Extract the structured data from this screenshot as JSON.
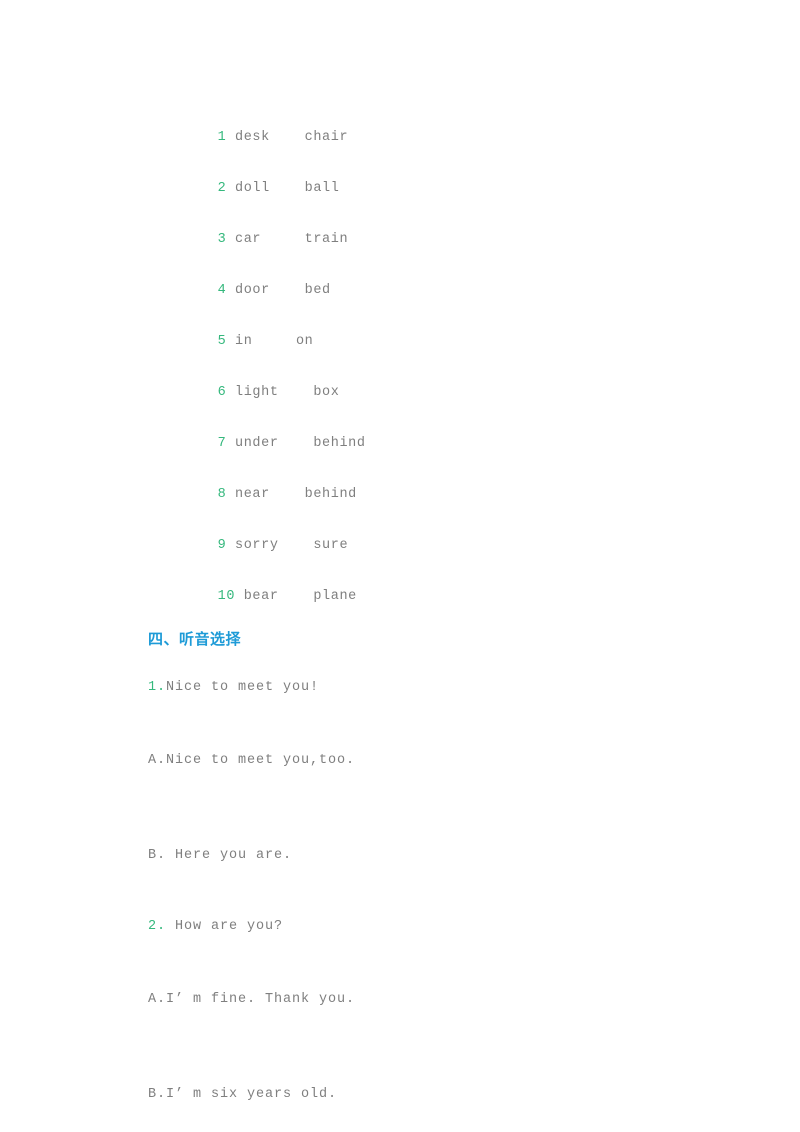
{
  "document": {
    "background_color": "#ffffff",
    "number_color": "#35b87d",
    "text_color": "#7f7f7f",
    "heading_color": "#1e9bd7"
  },
  "word_pairs": {
    "items": [
      {
        "number": "1",
        "word_a": "desk",
        "word_b": "chair",
        "gap": "    "
      },
      {
        "number": "2",
        "word_a": "doll",
        "word_b": "ball",
        "gap": "    "
      },
      {
        "number": "3",
        "word_a": "car",
        "word_b": "train",
        "gap": "     "
      },
      {
        "number": "4",
        "word_a": "door",
        "word_b": "bed",
        "gap": "    "
      },
      {
        "number": "5",
        "word_a": "in",
        "word_b": "on",
        "gap": "     "
      },
      {
        "number": "6",
        "word_a": "light",
        "word_b": "box",
        "gap": "    "
      },
      {
        "number": "7",
        "word_a": "under",
        "word_b": "behind",
        "gap": "    "
      },
      {
        "number": "8",
        "word_a": "near",
        "word_b": "behind",
        "gap": "    "
      },
      {
        "number": "9",
        "word_a": "sorry",
        "word_b": "sure",
        "gap": "    "
      },
      {
        "number": "10",
        "word_a": "bear",
        "word_b": "plane",
        "gap": "    "
      }
    ]
  },
  "section": {
    "heading": "四、听音选择"
  },
  "questions": [
    {
      "number": "1.",
      "stem": "Nice to meet you!",
      "options": [
        {
          "label": "A.",
          "text": "Nice to meet you,too."
        },
        {
          "label": "B. ",
          "text": "Here you are."
        }
      ]
    },
    {
      "number": "2. ",
      "stem": "How are you?",
      "options": [
        {
          "label": "A.",
          "text": "I’ m fine. Thank you."
        },
        {
          "label": "B.",
          "text": "I’ m six years old."
        }
      ]
    }
  ]
}
